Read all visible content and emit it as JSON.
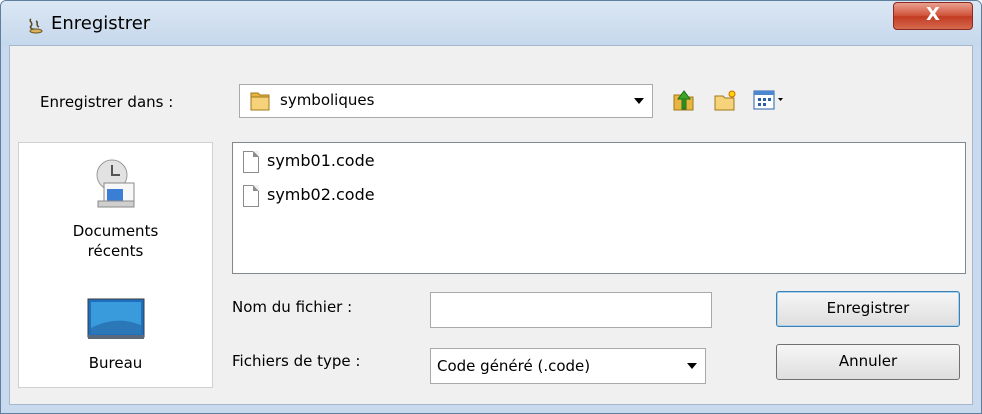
{
  "window": {
    "title": "Enregistrer",
    "close_glyph": "X"
  },
  "toolbar": {
    "save_in_label": "Enregistrer dans :",
    "folder_value": "symboliques",
    "icons": [
      "up-folder-icon",
      "new-folder-icon",
      "view-menu-icon"
    ]
  },
  "sidebar": {
    "items": [
      {
        "label_line1": "Documents",
        "label_line2": "récents",
        "icon": "recent-documents-icon"
      },
      {
        "label_line1": "Bureau",
        "icon": "desktop-icon"
      }
    ]
  },
  "files": [
    {
      "name": "symb01.code"
    },
    {
      "name": "symb02.code"
    }
  ],
  "form": {
    "filename_label": "Nom du fichier :",
    "filename_value": "",
    "filetype_label": "Fichiers de type :",
    "filetype_value": "Code généré (.code)"
  },
  "buttons": {
    "save": "Enregistrer",
    "cancel": "Annuler"
  },
  "colors": {
    "title_bg": "#c9daee",
    "close_red": "#c23b22",
    "client_bg": "#f0f0f0",
    "default_border": "#3c7fb1"
  }
}
